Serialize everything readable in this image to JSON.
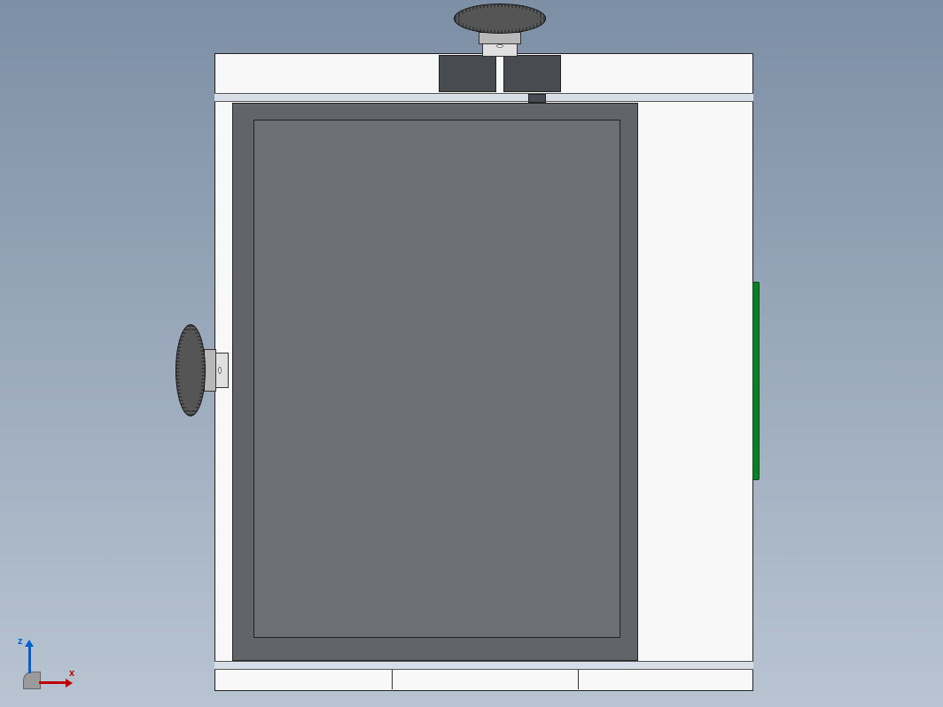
{
  "scene": {
    "object_name": "mechanical-assembly-front-view",
    "background_gradient_top": "#7d8fa5",
    "background_gradient_bottom": "#b8c4d2"
  },
  "triad": {
    "x_label": "x",
    "z_label": "z",
    "x_color": "#c00000",
    "z_color": "#0060d0"
  },
  "parts": {
    "main_body_color": "#f8f8f8",
    "frame_outer_color": "#616468",
    "frame_inner_color": "#6c6f73",
    "clamp_block_color": "#484b4f",
    "knob_cap_color": "#4a4a4a",
    "knob_shaft_color": "#e0e0e0",
    "green_plate_color": "#0a7f28"
  }
}
